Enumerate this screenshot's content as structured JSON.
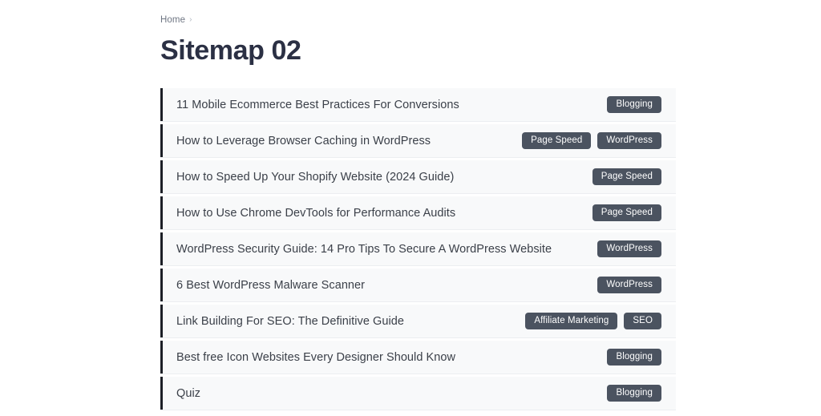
{
  "breadcrumb": {
    "items": [
      {
        "label": "Home"
      }
    ],
    "separator": "›"
  },
  "header": {
    "title": "Sitemap 02"
  },
  "colors": {
    "page_background": "#ffffff",
    "row_background": "#f8f9fa",
    "row_accent_bar": "#1c1f26",
    "row_divider": "#eceef1",
    "title_text": "#2b3044",
    "row_title_text": "#3b4049",
    "breadcrumb_text": "#6f7683",
    "tag_background": "#4b5360",
    "tag_text": "#ffffff"
  },
  "sitemap": {
    "rows": [
      {
        "title": "11 Mobile Ecommerce Best Practices For Conversions",
        "tags": [
          "Blogging"
        ]
      },
      {
        "title": "How to Leverage Browser Caching in WordPress",
        "tags": [
          "Page Speed",
          "WordPress"
        ]
      },
      {
        "title": "How to Speed Up Your Shopify Website (2024 Guide)",
        "tags": [
          "Page Speed"
        ]
      },
      {
        "title": "How to Use Chrome DevTools for Performance Audits",
        "tags": [
          "Page Speed"
        ]
      },
      {
        "title": "WordPress Security Guide: 14 Pro Tips To Secure A WordPress Website",
        "tags": [
          "WordPress"
        ]
      },
      {
        "title": "6 Best WordPress Malware Scanner",
        "tags": [
          "WordPress"
        ]
      },
      {
        "title": "Link Building For SEO: The Definitive Guide",
        "tags": [
          "Affiliate Marketing",
          "SEO"
        ]
      },
      {
        "title": "Best free Icon Websites Every Designer Should Know",
        "tags": [
          "Blogging"
        ]
      },
      {
        "title": "Quiz",
        "tags": [
          "Blogging"
        ]
      }
    ]
  }
}
